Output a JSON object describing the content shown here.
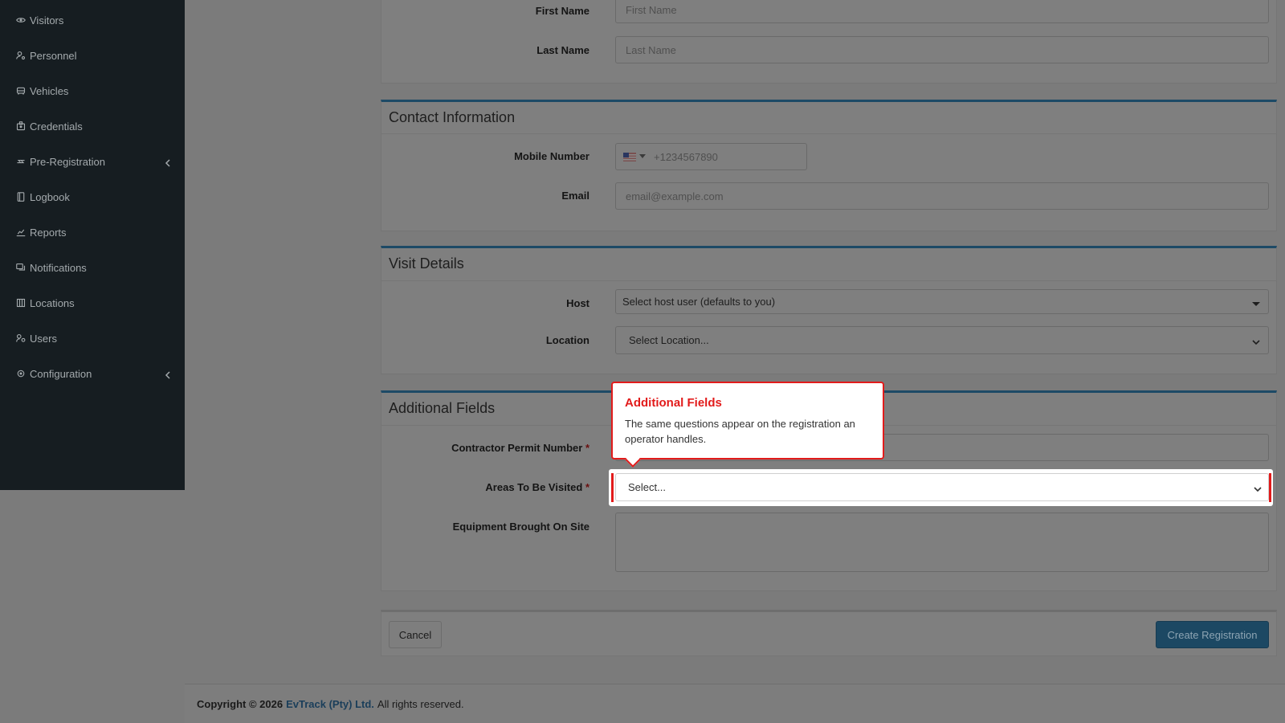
{
  "sidebar": {
    "items": [
      {
        "label": "Visitors",
        "icon": "eye-icon"
      },
      {
        "label": "Personnel",
        "icon": "user-cog-icon"
      },
      {
        "label": "Vehicles",
        "icon": "car-icon"
      },
      {
        "label": "Credentials",
        "icon": "id-card-icon"
      },
      {
        "label": "Pre-Registration",
        "icon": "swap-icon",
        "has_submenu": true
      },
      {
        "label": "Logbook",
        "icon": "book-icon"
      },
      {
        "label": "Reports",
        "icon": "chart-icon"
      },
      {
        "label": "Notifications",
        "icon": "chat-icon"
      },
      {
        "label": "Locations",
        "icon": "building-icon"
      },
      {
        "label": "Users",
        "icon": "users-icon"
      },
      {
        "label": "Configuration",
        "icon": "gear-icon",
        "has_submenu": true
      }
    ]
  },
  "personal": {
    "first_name_label": "First Name",
    "first_name_placeholder": "First Name",
    "last_name_label": "Last Name",
    "last_name_placeholder": "Last Name"
  },
  "contact": {
    "title": "Contact Information",
    "mobile_label": "Mobile Number",
    "mobile_placeholder": "+1234567890",
    "email_label": "Email",
    "email_placeholder": "email@example.com"
  },
  "visit": {
    "title": "Visit Details",
    "host_label": "Host",
    "host_value": "Select host user (defaults to you)",
    "location_label": "Location",
    "location_value": "Select Location..."
  },
  "additional": {
    "title": "Additional Fields",
    "permit_label": "Contractor Permit Number",
    "areas_label": "Areas To Be Visited",
    "areas_value": "Select...",
    "equipment_label": "Equipment Brought On Site",
    "required_marker": "*"
  },
  "tooltip": {
    "title": "Additional Fields",
    "body": "The same questions appear on the registration an operator handles."
  },
  "actions": {
    "cancel_label": "Cancel",
    "create_label": "Create Registration"
  },
  "footer": {
    "copyright": "Copyright © 2026",
    "company": "EvTrack (Pty) Ltd.",
    "rights": "All rights reserved."
  },
  "colors": {
    "sidebar_bg": "#161d21",
    "accent": "#1d4a66",
    "tooltip_red": "#e21b1b"
  }
}
